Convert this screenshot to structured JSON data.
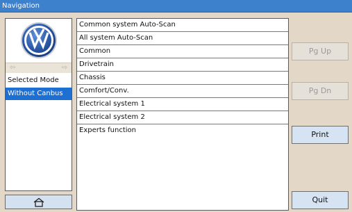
{
  "window": {
    "title": "Navigation"
  },
  "brand": {
    "logo_icon": "volkswagen-logo",
    "colors": {
      "logo_blue": "#2a57a7",
      "selection": "#1d6fd1",
      "titlebar": "#3d80cc"
    }
  },
  "left_nav": {
    "back_icon": "arrow-left-icon",
    "forward_icon": "arrow-right-icon",
    "modes": [
      "Selected Mode",
      "Without Canbus"
    ],
    "selected_index": 1,
    "home_icon": "home-icon"
  },
  "menu": {
    "items": [
      "Common system Auto-Scan",
      "All system Auto-Scan",
      "Common",
      "Drivetrain",
      "Chassis",
      "Comfort/Conv.",
      "Electrical system 1",
      "Electrical system 2",
      "Experts function"
    ]
  },
  "buttons": {
    "page_up": "Pg Up",
    "page_down": "Pg Dn",
    "print": "Print",
    "quit": "Quit"
  }
}
